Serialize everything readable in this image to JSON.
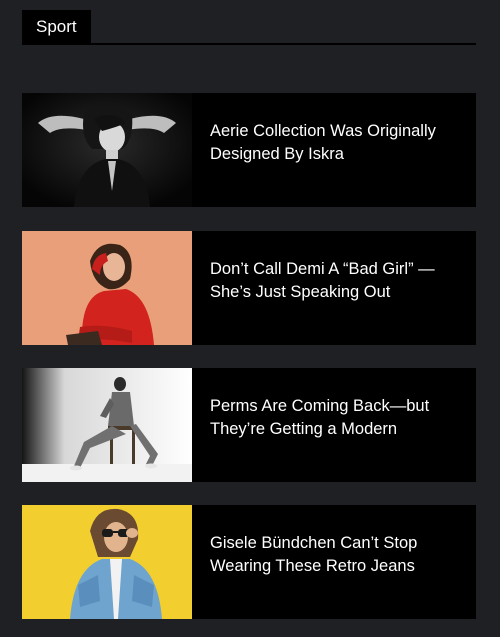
{
  "section": {
    "title": "Sport"
  },
  "articles": [
    {
      "title": "Aerie Collection Was Originally Designed By Iskra",
      "image": "woman-bw-portrait"
    },
    {
      "title": "Don’t Call Demi A “Bad Girl” — She’s Just Speaking Out",
      "image": "woman-red-sweater-peach-background"
    },
    {
      "title": "Perms Are Coming Back—but They’re Getting a Modern",
      "image": "man-sitting-on-chair-white-studio"
    },
    {
      "title": "Gisele Bündchen Can’t Stop Wearing These Retro Jeans",
      "image": "woman-sunglasses-yellow-background"
    }
  ],
  "colors": {
    "page_background": "#1f2023",
    "card_background": "#000000",
    "text": "#ffffff"
  }
}
